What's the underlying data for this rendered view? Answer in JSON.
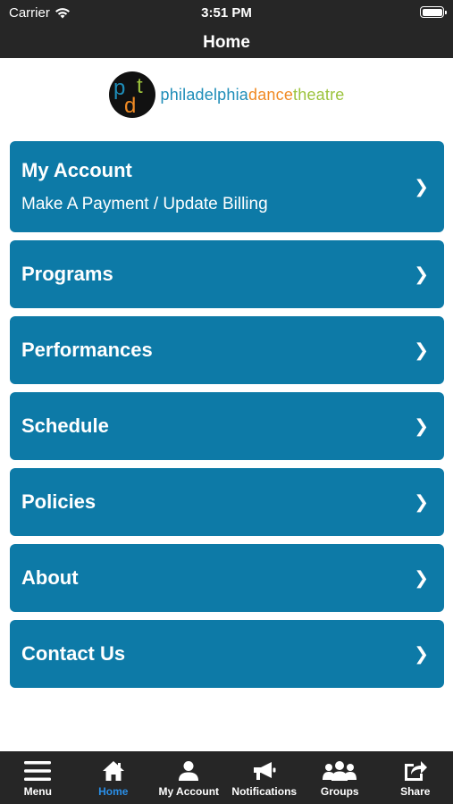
{
  "status": {
    "carrier": "Carrier",
    "time": "3:51 PM"
  },
  "header": {
    "title": "Home"
  },
  "logo": {
    "part1": "philadelphia",
    "part2": "dance",
    "part3": "theatre",
    "mark_letters": [
      "p",
      "d",
      "t"
    ]
  },
  "menu": {
    "items": [
      {
        "title": "My Account",
        "subtitle": "Make A Payment / Update Billing",
        "chevron": "❯"
      },
      {
        "title": "Programs",
        "chevron": "❯"
      },
      {
        "title": "Performances",
        "chevron": "❯"
      },
      {
        "title": "Schedule",
        "chevron": "❯"
      },
      {
        "title": "Policies",
        "chevron": "❯"
      },
      {
        "title": "About",
        "chevron": "❯"
      },
      {
        "title": "Contact Us",
        "chevron": "❯"
      }
    ]
  },
  "tabbar": {
    "tabs": [
      {
        "label": "Menu",
        "icon": "hamburger-icon"
      },
      {
        "label": "Home",
        "icon": "home-icon",
        "active": true
      },
      {
        "label": "My Account",
        "icon": "person-icon"
      },
      {
        "label": "Notifications",
        "icon": "megaphone-icon"
      },
      {
        "label": "Groups",
        "icon": "group-icon"
      },
      {
        "label": "Share",
        "icon": "share-icon"
      }
    ]
  },
  "colors": {
    "bar": "#262626",
    "tile": "#0d7aa7",
    "active_tab": "#2a8ee6"
  }
}
